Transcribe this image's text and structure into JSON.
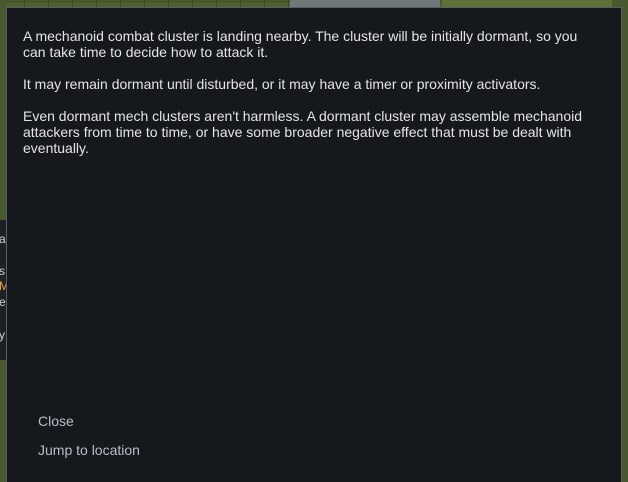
{
  "left_strip_fragments": [
    "a",
    "s",
    "M",
    "e",
    "y"
  ],
  "dialog": {
    "paragraphs": [
      "A mechanoid combat cluster is landing nearby. The cluster will be initially dormant, so you can take time to decide how to attack it.",
      "It may remain dormant until disturbed, or it may have a timer or proximity activators.",
      "Even dormant mech clusters aren't harmless. A dormant cluster may assemble mechanoid attackers from time to time, or have some broader negative effect that must be dealt with eventually."
    ],
    "options": [
      {
        "label": "Close"
      },
      {
        "label": "Jump to location"
      }
    ]
  },
  "colors": {
    "dialog_bg": "#15191e",
    "dialog_text": "#e4e4e4",
    "option_text": "#b8bec6",
    "alert_highlight": "#e0a23a"
  }
}
